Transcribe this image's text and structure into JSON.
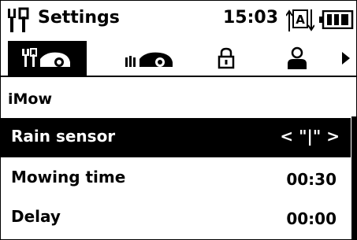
{
  "status": {
    "title": "Settings",
    "time": "15:03",
    "auto_icon_letter": "A"
  },
  "tabs": [
    {
      "icon": "settings-robot-icon",
      "active": true
    },
    {
      "icon": "mower-icon",
      "active": false
    },
    {
      "icon": "lock-icon",
      "active": false
    },
    {
      "icon": "user-icon",
      "active": false
    }
  ],
  "section": {
    "title": "iMow"
  },
  "rows": [
    {
      "label": "Rain sensor",
      "value": "< \"|\" >",
      "selected": true
    },
    {
      "label": "Mowing time",
      "value": "00:30",
      "selected": false
    },
    {
      "label": "Delay",
      "value": "00:00",
      "selected": false
    }
  ]
}
